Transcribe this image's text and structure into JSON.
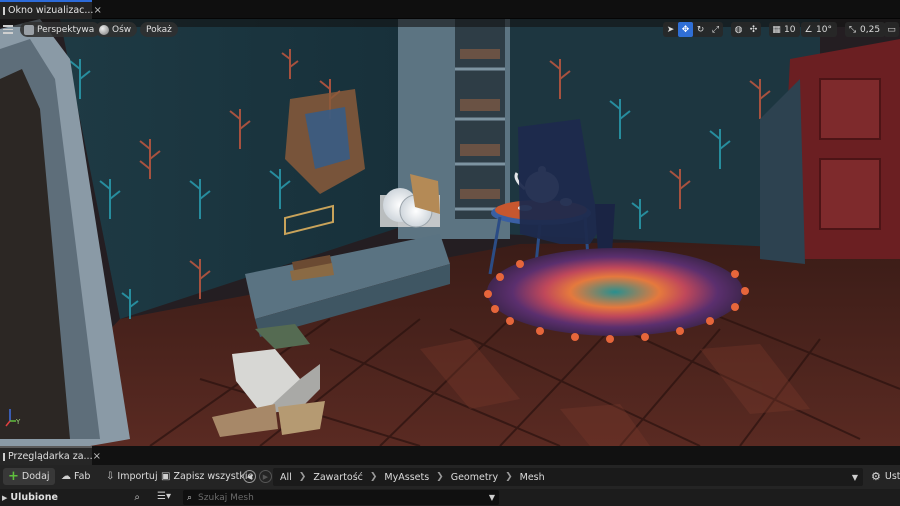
{
  "window": {
    "tab_title": "Okno wizualizac...",
    "tab_close": "×"
  },
  "viewport": {
    "menu_icon": "hamburger-icon",
    "view_mode": "Perspektywa",
    "lighting": "Ośw",
    "show": "Pokaż",
    "tools": [
      "select-icon",
      "translate-icon",
      "rotate-icon",
      "scale-icon"
    ],
    "grid_snap": "10",
    "rotation_snap": "10°",
    "scale_snap": "0,25",
    "axis_labels": {
      "y": "Y"
    }
  },
  "content_browser": {
    "tab_title": "Przeglądarka za...",
    "tab_close": "×",
    "add_label": "Dodaj",
    "fab_label": "Fab",
    "import_label": "Importuj",
    "save_all_label": "Zapisz wszystkie",
    "breadcrumbs": [
      "All",
      "Zawartość",
      "MyAssets",
      "Geometry",
      "Mesh"
    ],
    "settings_label": "Ust",
    "favorites_label": "Ulubione",
    "search_placeholder": "Szukaj Mesh"
  },
  "colors": {
    "accent": "#2f6fd6",
    "add_plus": "#5fbf3d"
  }
}
